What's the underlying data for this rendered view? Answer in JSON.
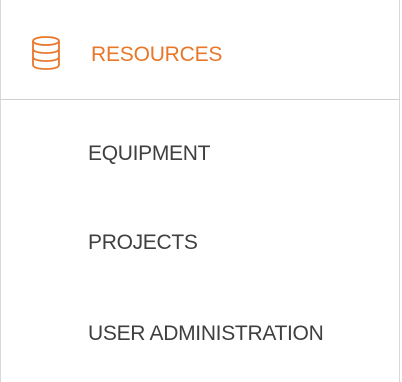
{
  "header": {
    "label": "RESOURCES",
    "icon": "database-icon",
    "color": "#e8772a"
  },
  "menu": {
    "items": [
      {
        "label": "EQUIPMENT"
      },
      {
        "label": "PROJECTS"
      },
      {
        "label": "USER ADMINISTRATION"
      }
    ]
  }
}
